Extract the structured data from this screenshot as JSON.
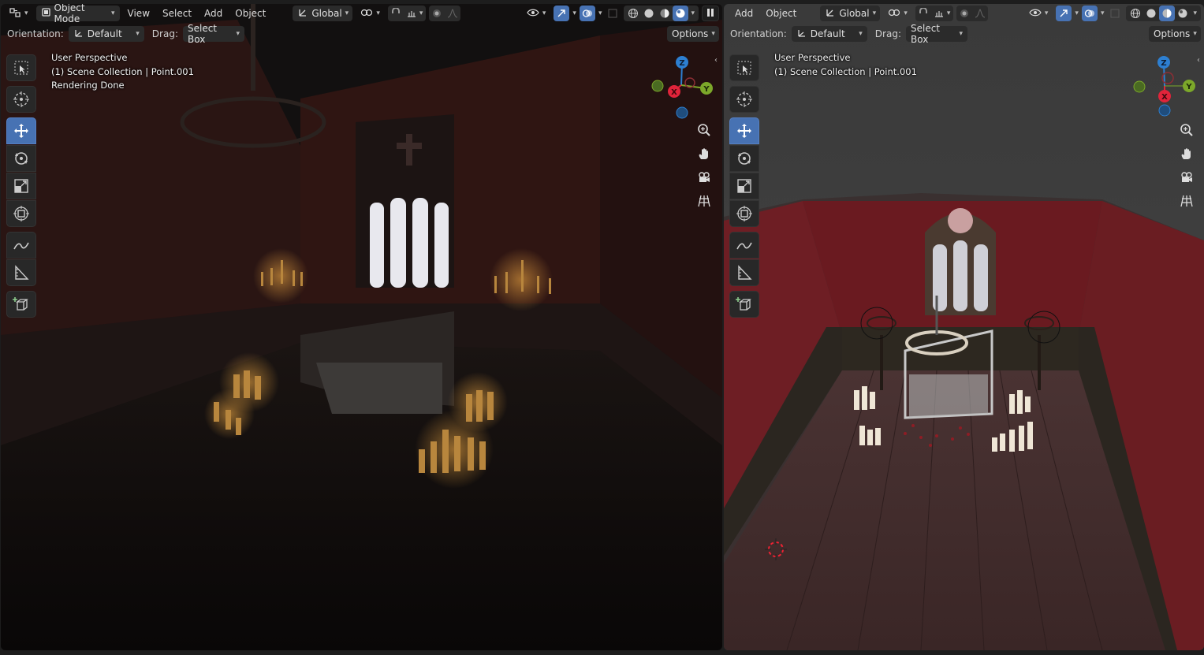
{
  "left_viewport": {
    "header": {
      "mode": "Object Mode",
      "menus": [
        "View",
        "Select",
        "Add",
        "Object"
      ],
      "transform_orientation": "Global"
    },
    "header2": {
      "orientation_label": "Orientation:",
      "orientation_value": "Default",
      "drag_label": "Drag:",
      "drag_value": "Select Box",
      "options_label": "Options"
    },
    "overlay": {
      "perspective": "User Perspective",
      "collection": "(1) Scene Collection | Point.001",
      "status": "Rendering Done"
    },
    "gizmo": {
      "x": "X",
      "y": "Y",
      "z": "Z"
    }
  },
  "right_viewport": {
    "header": {
      "menus": [
        "Add",
        "Object"
      ],
      "transform_orientation": "Global"
    },
    "header2": {
      "orientation_label": "Orientation:",
      "orientation_value": "Default",
      "drag_label": "Drag:",
      "drag_value": "Select Box",
      "options_label": "Options"
    },
    "overlay": {
      "perspective": "User Perspective",
      "collection": "(1) Scene Collection | Point.001"
    },
    "gizmo": {
      "x": "X",
      "y": "Y",
      "z": "Z"
    }
  },
  "tools": [
    "select-box",
    "cursor",
    "move",
    "rotate",
    "scale",
    "transform",
    "annotate",
    "measure",
    "add-cube"
  ],
  "nav_icons": [
    "zoom-icon",
    "hand-pan-icon",
    "camera-icon",
    "grid-ortho-icon"
  ],
  "colors": {
    "active_blue": "#4772b3",
    "axis_x": "#e0243a",
    "axis_y": "#7ca82a",
    "axis_z": "#2d7fd1"
  }
}
